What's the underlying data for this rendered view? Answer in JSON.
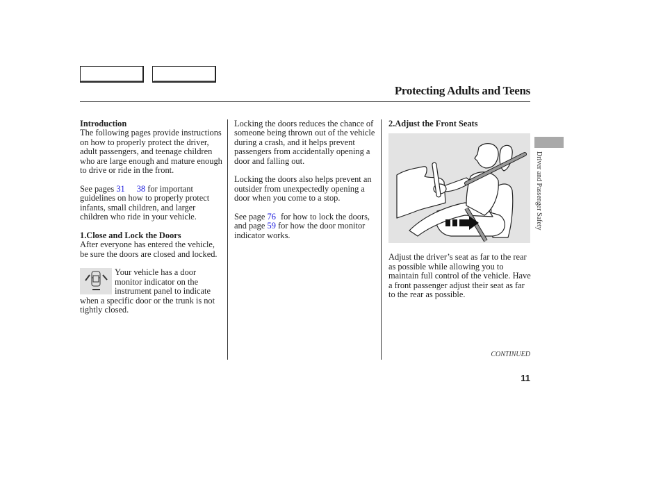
{
  "header": {
    "nav_buttons": [
      "",
      ""
    ],
    "title": "Protecting Adults and Teens"
  },
  "column1": {
    "intro_heading": "Introduction",
    "intro_text": "The following pages provide instructions on how to properly protect the driver, adult passengers, and teenage children who are large enough and mature enough to drive or ride in the front.",
    "see_pages_prefix": "See pages",
    "link_page_a": "31",
    "link_page_b": "38",
    "see_pages_suffix": "for important guidelines on how to properly protect infants, small children, and larger children who ride in your vehicle.",
    "step1_heading": "1.Close and Lock the Doors",
    "step1_text": "After everyone has entered the vehicle, be sure the doors are closed and locked.",
    "door_monitor_text": "Your vehicle has a door monitor indicator on the instrument panel to indicate when a specific door or the trunk is not tightly closed."
  },
  "column2": {
    "para1": "Locking the doors reduces the chance of someone being thrown out of the vehicle during a crash, and it helps prevent passengers from accidentally opening a door and falling out.",
    "para2": "Locking the doors also helps prevent an outsider from unexpectedly opening a door when you come to a stop.",
    "see_page_prefix": "See page",
    "link_page_lock": "76",
    "see_page_mid": "for how to lock the doors, and page",
    "link_page_monitor": "59",
    "see_page_suffix": "for how the door monitor indicator works."
  },
  "column3": {
    "step2_heading": "2.Adjust the Front Seats",
    "illustration_icon": "driver-seat-adjust-illustration",
    "step2_text": "Adjust the driver’s seat as far to the rear as possible while allowing you to maintain full control of the vehicle. Have a front passenger adjust their seat as far to the rear as possible."
  },
  "sidebar": {
    "section_label": "Driver and Passenger Safety"
  },
  "footer": {
    "continued": "CONTINUED",
    "page_number": "11"
  }
}
